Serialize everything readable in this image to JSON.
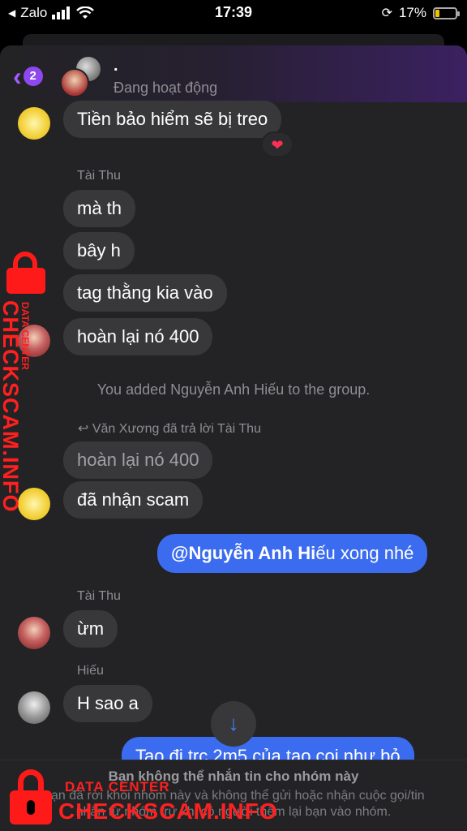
{
  "status_bar": {
    "carrier": "Zalo",
    "time": "17:39",
    "battery": "17%"
  },
  "header": {
    "back_badge": "2",
    "name": ".",
    "status": "Đang hoạt động"
  },
  "messages": [
    {
      "text": "Tiền bảo hiểm sẽ bị treo",
      "reaction": "❤"
    },
    {
      "sender": "Tài Thu"
    },
    {
      "text": "mà th"
    },
    {
      "text": "bây h"
    },
    {
      "text": "tag thằng kia vào"
    },
    {
      "text": "hoàn lại nó 400"
    },
    {
      "system": "You added Nguyễn Anh Hiếu to the group."
    },
    {
      "reply_label": "Văn Xương đã trả lời Tài Thu"
    },
    {
      "quote": "hoàn lại nó 400"
    },
    {
      "text": "đã nhận scam"
    },
    {
      "mention": "@Nguyễn Anh Hi",
      "rest": "ếu xong nhé"
    },
    {
      "sender": "Tài Thu"
    },
    {
      "text": "ừm"
    },
    {
      "sender": "Hiếu"
    },
    {
      "text": "H sao a"
    },
    {
      "text": "Tao đi trc 2m5 của tao coi như bỏ"
    }
  ],
  "composer": {
    "title": "Bạn không thể nhắn tin cho nhóm này",
    "text": "Bạn đã rời khỏi nhóm này và không thể gửi hoặc nhận cuộc gọi/tin nhắn từ nhóm trừ khi có người thêm lại bạn vào nhóm."
  },
  "watermark": {
    "small": "DATA CENTER",
    "big": "CHECKSCAM.INFO"
  },
  "colors": {
    "accent": "#8e48f0",
    "outgoing": "#3b6cf0",
    "watermark": "#ff2020"
  }
}
